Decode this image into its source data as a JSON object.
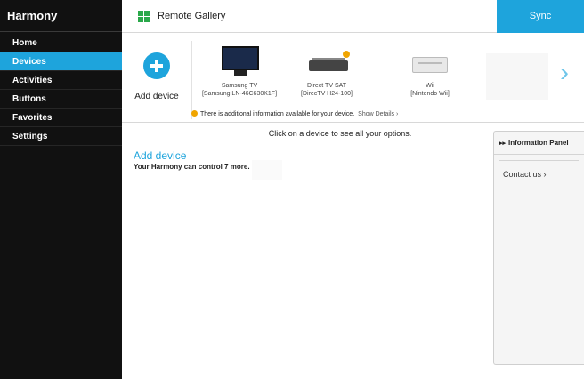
{
  "sidebar": {
    "app_title": "Harmony",
    "items": [
      {
        "label": "Home"
      },
      {
        "label": "Devices"
      },
      {
        "label": "Activities"
      },
      {
        "label": "Buttons"
      },
      {
        "label": "Favorites"
      },
      {
        "label": "Settings"
      }
    ],
    "active_item": "Devices"
  },
  "topbar": {
    "gallery_title": "Remote Gallery",
    "sync_label": "Sync"
  },
  "device_strip": {
    "add_label": "Add device",
    "devices": [
      {
        "name": "Samsung TV",
        "model": "[Samsung LN-46C630K1F]",
        "icon": "tv-icon"
      },
      {
        "name": "Direct TV SAT",
        "model": "[DirecTV H24-100]",
        "icon": "set-top-box-icon"
      },
      {
        "name": "Wii",
        "model": "[Nintendo Wii]",
        "icon": "game-console-icon"
      }
    ],
    "info_text": "There is additional information available for your device.",
    "show_details": "Show Details",
    "next_icon": "chevron-right-icon"
  },
  "main": {
    "hint": "Click on a device to see all your options.",
    "add_device_link": "Add device",
    "control_more": "Your Harmony can control 7 more."
  },
  "info_panel": {
    "title": "Information Panel",
    "contact": "Contact us"
  },
  "colors": {
    "accent": "#1ea4dc",
    "sidebar_bg": "#111111",
    "warning": "#f0a500",
    "gallery_icon": "#2aa84a"
  }
}
